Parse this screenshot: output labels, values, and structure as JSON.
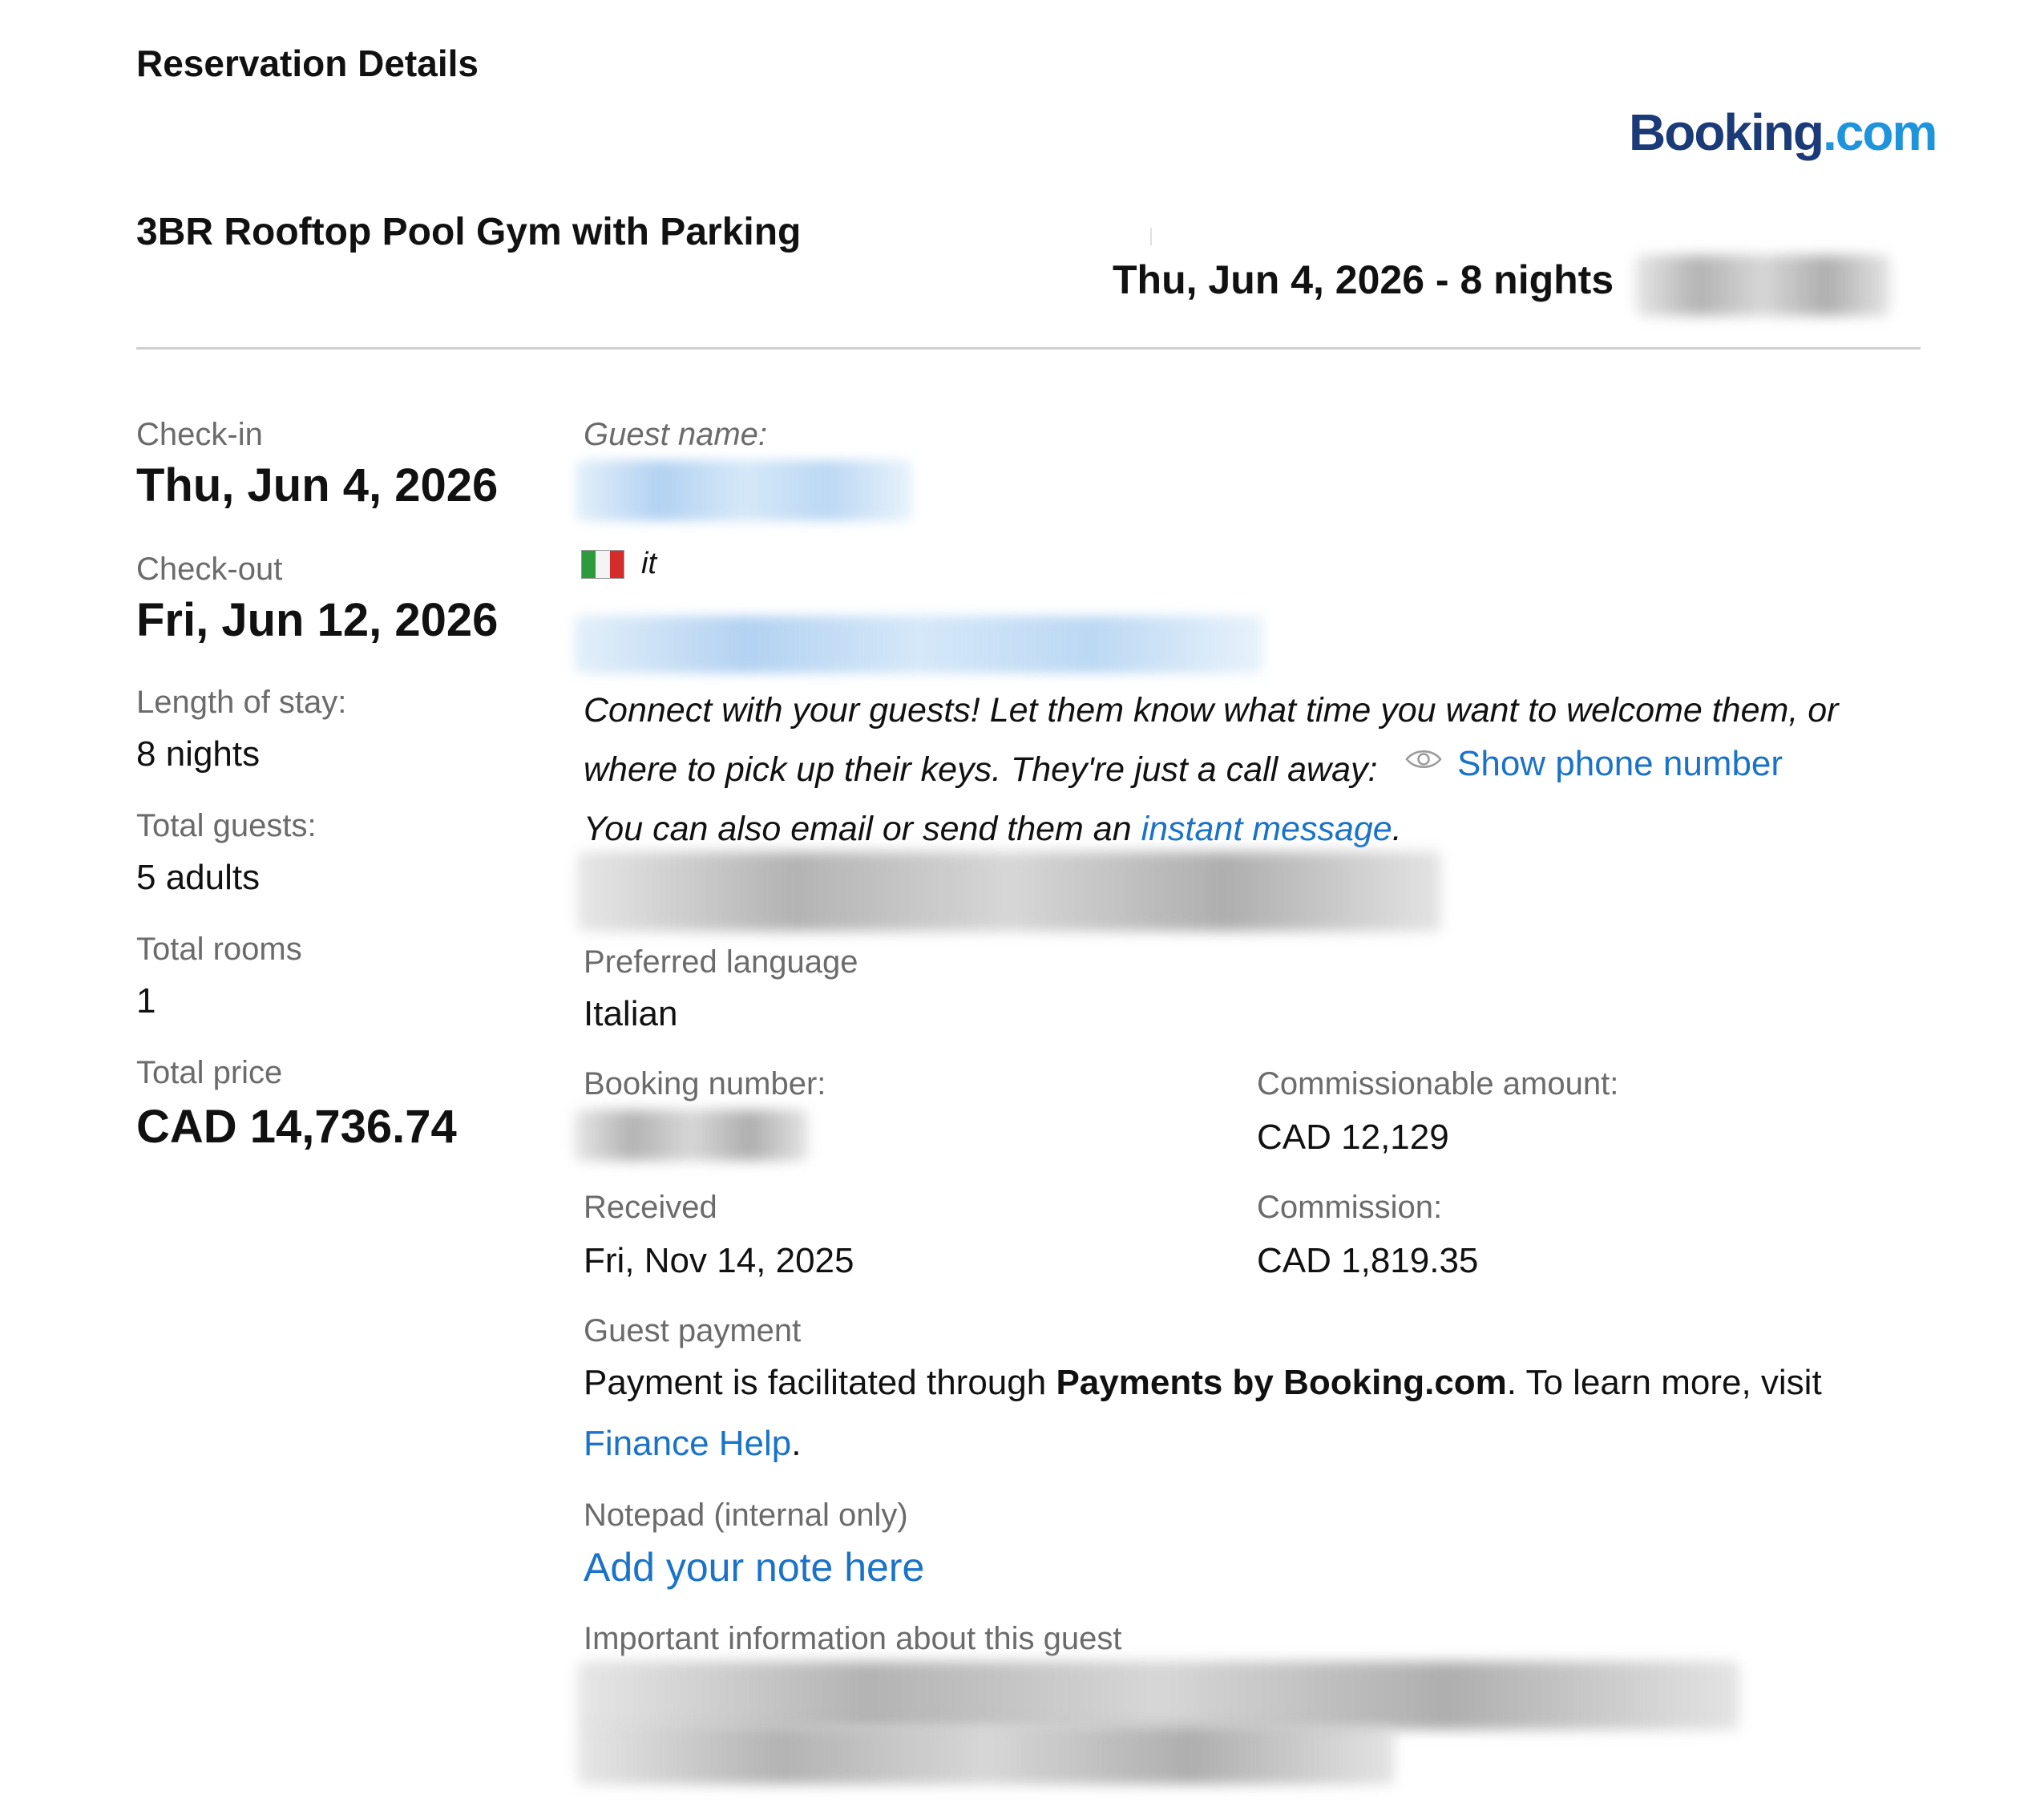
{
  "header": {
    "title": "Reservation Details",
    "logo": {
      "part1": "Booking",
      "part2": ".com"
    }
  },
  "property": {
    "name": "3BR Rooftop Pool Gym with Parking",
    "stay_summary": "Thu, Jun 4, 2026 - 8 nights"
  },
  "summary": {
    "checkin_label": "Check-in",
    "checkin_value": "Thu, Jun 4, 2026",
    "checkout_label": "Check-out",
    "checkout_value": "Fri, Jun 12, 2026",
    "length_label": "Length of stay:",
    "length_value": "8 nights",
    "guests_label": "Total guests:",
    "guests_value": "5 adults",
    "rooms_label": "Total rooms",
    "rooms_value": "1",
    "price_label": "Total price",
    "price_value": "CAD 14,736.74"
  },
  "guest": {
    "name_label": "Guest name:",
    "country_code": "it",
    "connect_line1": "Connect with your guests! Let them know what time you want to welcome them, or",
    "connect_line2": "where to pick up their keys. They're just a call away:",
    "show_phone": "Show phone number",
    "email_prefix": "You can also email or send them an ",
    "instant_message": "instant message",
    "email_suffix": ".",
    "pref_lang_label": "Preferred language",
    "pref_lang_value": "Italian"
  },
  "booking": {
    "number_label": "Booking number:",
    "received_label": "Received",
    "received_value": "Fri, Nov 14, 2025",
    "commissionable_label": "Commissionable amount:",
    "commissionable_value": "CAD 12,129",
    "commission_label": "Commission:",
    "commission_value": "CAD 1,819.35"
  },
  "payment": {
    "label": "Guest payment",
    "text_prefix": "Payment is facilitated through ",
    "text_bold": "Payments by Booking.com",
    "text_suffix": ". To learn more, visit",
    "finance_link": "Finance Help",
    "finance_suffix": "."
  },
  "notepad": {
    "label": "Notepad (internal only)",
    "add_note": "Add your note here"
  },
  "important": {
    "label": "Important information about this guest"
  },
  "icons": {
    "eye": "eye-icon",
    "flag": "italy-flag-icon"
  },
  "colors": {
    "link": "#1a73c8",
    "logo_dark": "#1a3a78",
    "logo_light": "#1e94dc"
  }
}
